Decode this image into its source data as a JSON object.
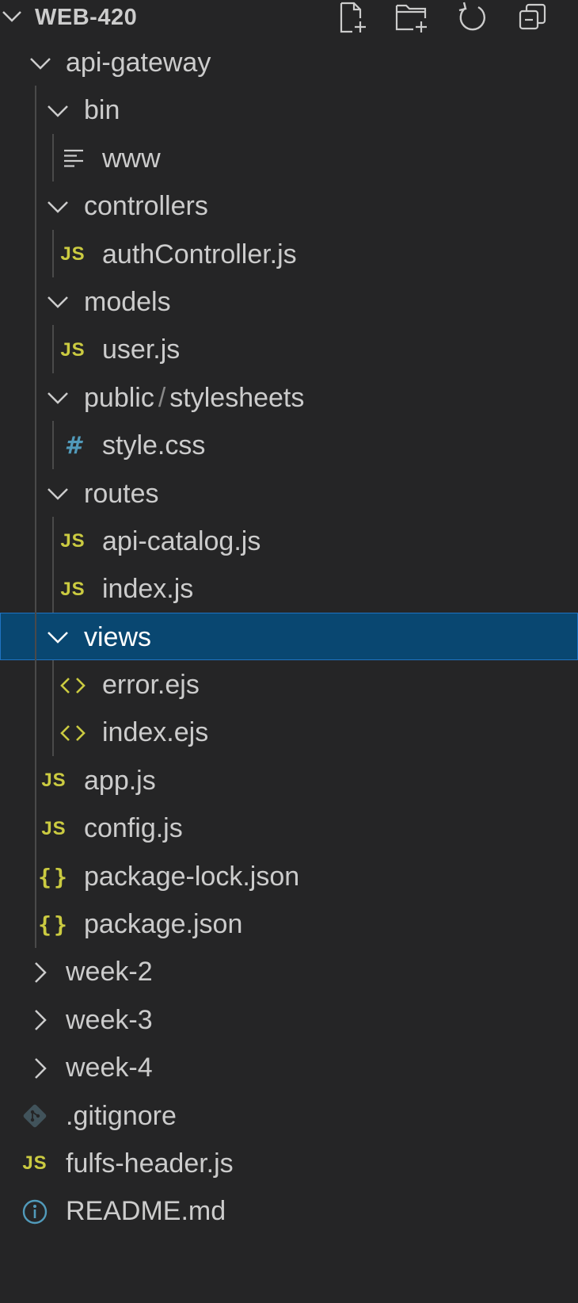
{
  "explorer": {
    "title": "WEB-420",
    "actions": [
      {
        "name": "new-file-icon"
      },
      {
        "name": "new-folder-icon"
      },
      {
        "name": "refresh-icon"
      },
      {
        "name": "collapse-all-icon"
      }
    ]
  },
  "tree": [
    {
      "label": "api-gateway",
      "type": "folder",
      "expanded": true,
      "depth": 1
    },
    {
      "label": "bin",
      "type": "folder",
      "expanded": true,
      "depth": 2
    },
    {
      "label": "www",
      "type": "text-file",
      "depth": 3
    },
    {
      "label": "controllers",
      "type": "folder",
      "expanded": true,
      "depth": 2
    },
    {
      "label": "authController.js",
      "type": "js",
      "depth": 3
    },
    {
      "label": "models",
      "type": "folder",
      "expanded": true,
      "depth": 2
    },
    {
      "label": "user.js",
      "type": "js",
      "depth": 3
    },
    {
      "label": "public",
      "label2": "stylesheets",
      "type": "folder",
      "expanded": true,
      "depth": 2
    },
    {
      "label": "style.css",
      "type": "css",
      "depth": 3
    },
    {
      "label": "routes",
      "type": "folder",
      "expanded": true,
      "depth": 2
    },
    {
      "label": "api-catalog.js",
      "type": "js",
      "depth": 3
    },
    {
      "label": "index.js",
      "type": "js",
      "depth": 3
    },
    {
      "label": "views",
      "type": "folder",
      "expanded": true,
      "depth": 2,
      "selected": true
    },
    {
      "label": "error.ejs",
      "type": "ejs",
      "depth": 3
    },
    {
      "label": "index.ejs",
      "type": "ejs",
      "depth": 3
    },
    {
      "label": "app.js",
      "type": "js",
      "depth": 2
    },
    {
      "label": "config.js",
      "type": "js",
      "depth": 2
    },
    {
      "label": "package-lock.json",
      "type": "json",
      "depth": 2
    },
    {
      "label": "package.json",
      "type": "json",
      "depth": 2
    },
    {
      "label": "week-2",
      "type": "folder",
      "expanded": false,
      "depth": 1
    },
    {
      "label": "week-3",
      "type": "folder",
      "expanded": false,
      "depth": 1
    },
    {
      "label": "week-4",
      "type": "folder",
      "expanded": false,
      "depth": 1
    },
    {
      "label": ".gitignore",
      "type": "git",
      "depth": 1
    },
    {
      "label": "fulfs-header.js",
      "type": "js",
      "depth": 1
    },
    {
      "label": "README.md",
      "type": "info",
      "depth": 1
    }
  ],
  "colors": {
    "background": "#252526",
    "selection": "#094771",
    "selection_border": "#1f73c2",
    "text": "#cccccc",
    "js_icon": "#cbcb41",
    "css_icon": "#519aba",
    "git_icon": "#41535b",
    "info_icon": "#519aba"
  }
}
